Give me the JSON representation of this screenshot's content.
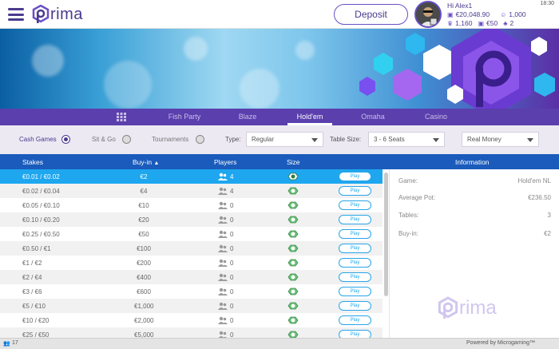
{
  "header": {
    "logo_text": "rima",
    "deposit_label": "Deposit",
    "greeting": "Hi Alex1",
    "balance": "€20,048.90",
    "points": "1,000",
    "stat1": "1,160",
    "stat2": "€50",
    "stat3": "2",
    "clock": "18:30",
    "accent": "#4b3a8e"
  },
  "nav": {
    "tabs": [
      "Fish Party",
      "Blaze",
      "Hold'em",
      "Omaha",
      "Casino"
    ],
    "active": "Hold'em"
  },
  "filters": {
    "cash_games": "Cash Games",
    "sit_go": "Sit & Go",
    "tournaments": "Tournaments",
    "type_label": "Type:",
    "type_value": "Regular",
    "table_size_label": "Table Size:",
    "table_size_value": "3 - 6 Seats",
    "money_value": "Real Money"
  },
  "table": {
    "headers": {
      "stakes": "Stakes",
      "buyin": "Buy-in",
      "players": "Players",
      "size": "Size",
      "info": "Information"
    },
    "play_label": "Play",
    "rows": [
      {
        "stakes": "€0.01 / €0.02",
        "buyin": "€2",
        "players": "4"
      },
      {
        "stakes": "€0.02 / €0.04",
        "buyin": "€4",
        "players": "4"
      },
      {
        "stakes": "€0.05 / €0.10",
        "buyin": "€10",
        "players": "0"
      },
      {
        "stakes": "€0.10 / €0.20",
        "buyin": "€20",
        "players": "0"
      },
      {
        "stakes": "€0.25 / €0.50",
        "buyin": "€50",
        "players": "0"
      },
      {
        "stakes": "€0.50 / €1",
        "buyin": "€100",
        "players": "0"
      },
      {
        "stakes": "€1 / €2",
        "buyin": "€200",
        "players": "0"
      },
      {
        "stakes": "€2 / €4",
        "buyin": "€400",
        "players": "0"
      },
      {
        "stakes": "€3 / €6",
        "buyin": "€600",
        "players": "0"
      },
      {
        "stakes": "€5 / €10",
        "buyin": "€1,000",
        "players": "0"
      },
      {
        "stakes": "€10 / €20",
        "buyin": "€2,000",
        "players": "0"
      },
      {
        "stakes": "€25 / €50",
        "buyin": "€5,000",
        "players": "0"
      }
    ]
  },
  "info": {
    "game_label": "Game:",
    "game_value": "Hold'em NL",
    "avg_pot_label": "Average Pot:",
    "avg_pot_value": "€236.50",
    "tables_label": "Tables:",
    "tables_value": "3",
    "buyin_label": "Buy-in:",
    "buyin_value": "€2",
    "logo_text": "rima"
  },
  "footer": {
    "online_count": "17",
    "powered": "Powered by Microgaming™"
  }
}
